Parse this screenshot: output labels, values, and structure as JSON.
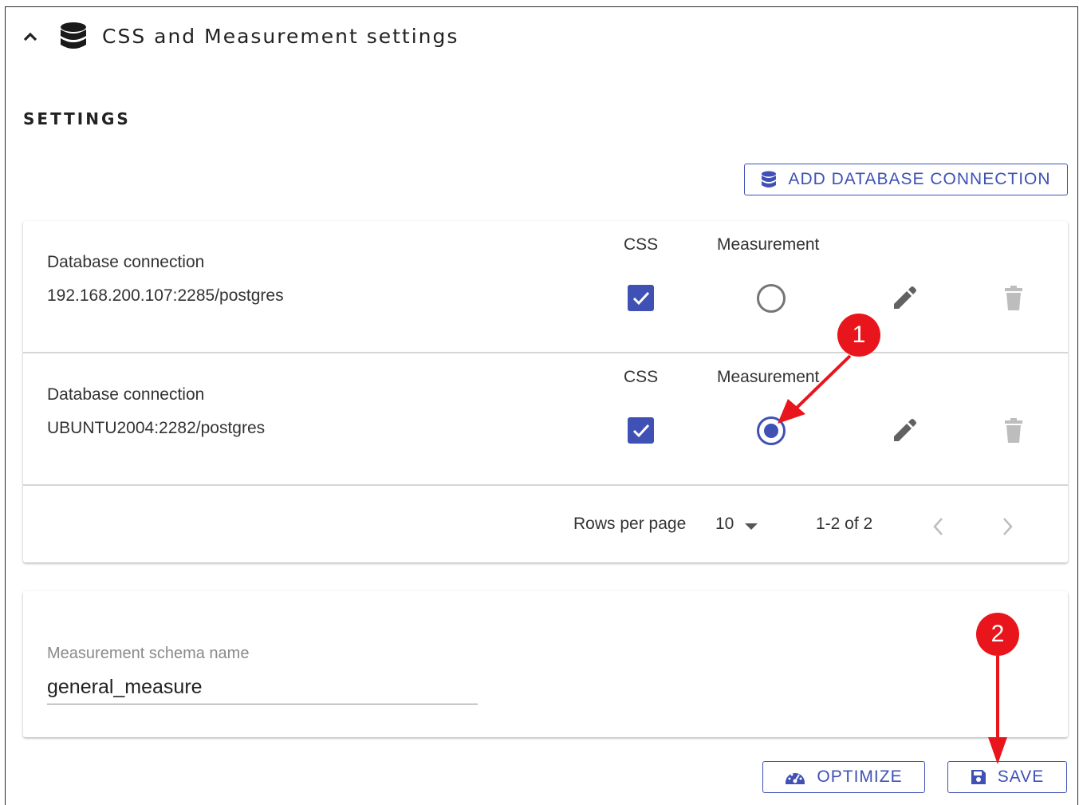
{
  "header": {
    "title": "CSS and Measurement settings",
    "collapse_icon": "chevron-up-icon",
    "db_icon": "database-icon"
  },
  "settings_heading": "SETTINGS",
  "add_db_button": {
    "label": "ADD DATABASE CONNECTION",
    "icon": "database-icon"
  },
  "table": {
    "col_css": "CSS",
    "col_measurement": "Measurement",
    "rows": [
      {
        "label": "Database connection",
        "value": "192.168.200.107:2285/postgres",
        "css_checked": true,
        "measurement_selected": false
      },
      {
        "label": "Database connection",
        "value": "UBUNTU2004:2282/postgres",
        "css_checked": true,
        "measurement_selected": true
      }
    ],
    "pagination": {
      "rows_per_page_label": "Rows per page",
      "rows_per_page_value": "10",
      "range": "1-2 of 2"
    }
  },
  "schema": {
    "label": "Measurement schema name",
    "value": "general_measure"
  },
  "buttons": {
    "optimize": "OPTIMIZE",
    "save": "SAVE"
  },
  "annotations": [
    "1",
    "2"
  ],
  "colors": {
    "primary": "#3f51b5",
    "annotation": "#e8161c",
    "icon_gray": "#616161",
    "disabled_gray": "#bdbdbd"
  }
}
